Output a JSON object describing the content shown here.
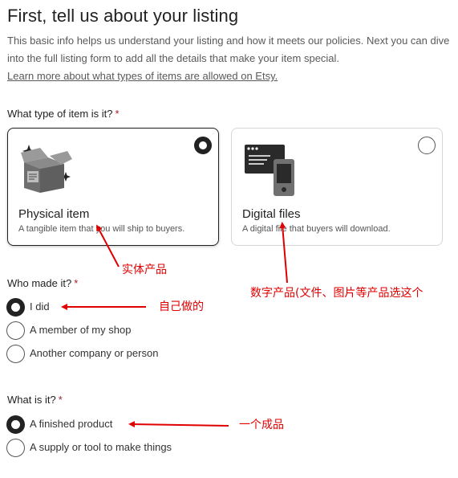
{
  "header": {
    "title": "First, tell us about your listing",
    "intro": "This basic info helps us understand your listing and how it meets our policies. Next you can dive into the full listing form to add all the details that make your item special.",
    "learn_more_link": "Learn more about what types of items are allowed on Etsy."
  },
  "item_type": {
    "label": "What type of item is it?",
    "required_marker": "*",
    "options": [
      {
        "title": "Physical item",
        "description": "A tangible item that you will ship to buyers.",
        "selected": true,
        "icon": "box-icon"
      },
      {
        "title": "Digital files",
        "description": "A digital file that buyers will download.",
        "selected": false,
        "icon": "devices-icon"
      }
    ]
  },
  "who_made": {
    "label": "Who made it?",
    "required_marker": "*",
    "options": [
      {
        "label": "I did",
        "selected": true
      },
      {
        "label": "A member of my shop",
        "selected": false
      },
      {
        "label": "Another company or person",
        "selected": false
      }
    ]
  },
  "what_is": {
    "label": "What is it?",
    "required_marker": "*",
    "options": [
      {
        "label": "A finished product",
        "selected": true
      },
      {
        "label": "A supply or tool to make things",
        "selected": false
      }
    ]
  },
  "annotations": {
    "physical": "实体产品",
    "digital": "数字产品(文件、图片等产品选这个",
    "i_did": "自己做的",
    "finished": "一个成品",
    "color": "#e00000"
  },
  "colors": {
    "text": "#222222",
    "required": "#a61a2e",
    "muted": "#595959",
    "selected_border": "#222222",
    "unselected_border": "#d6d6d6"
  }
}
